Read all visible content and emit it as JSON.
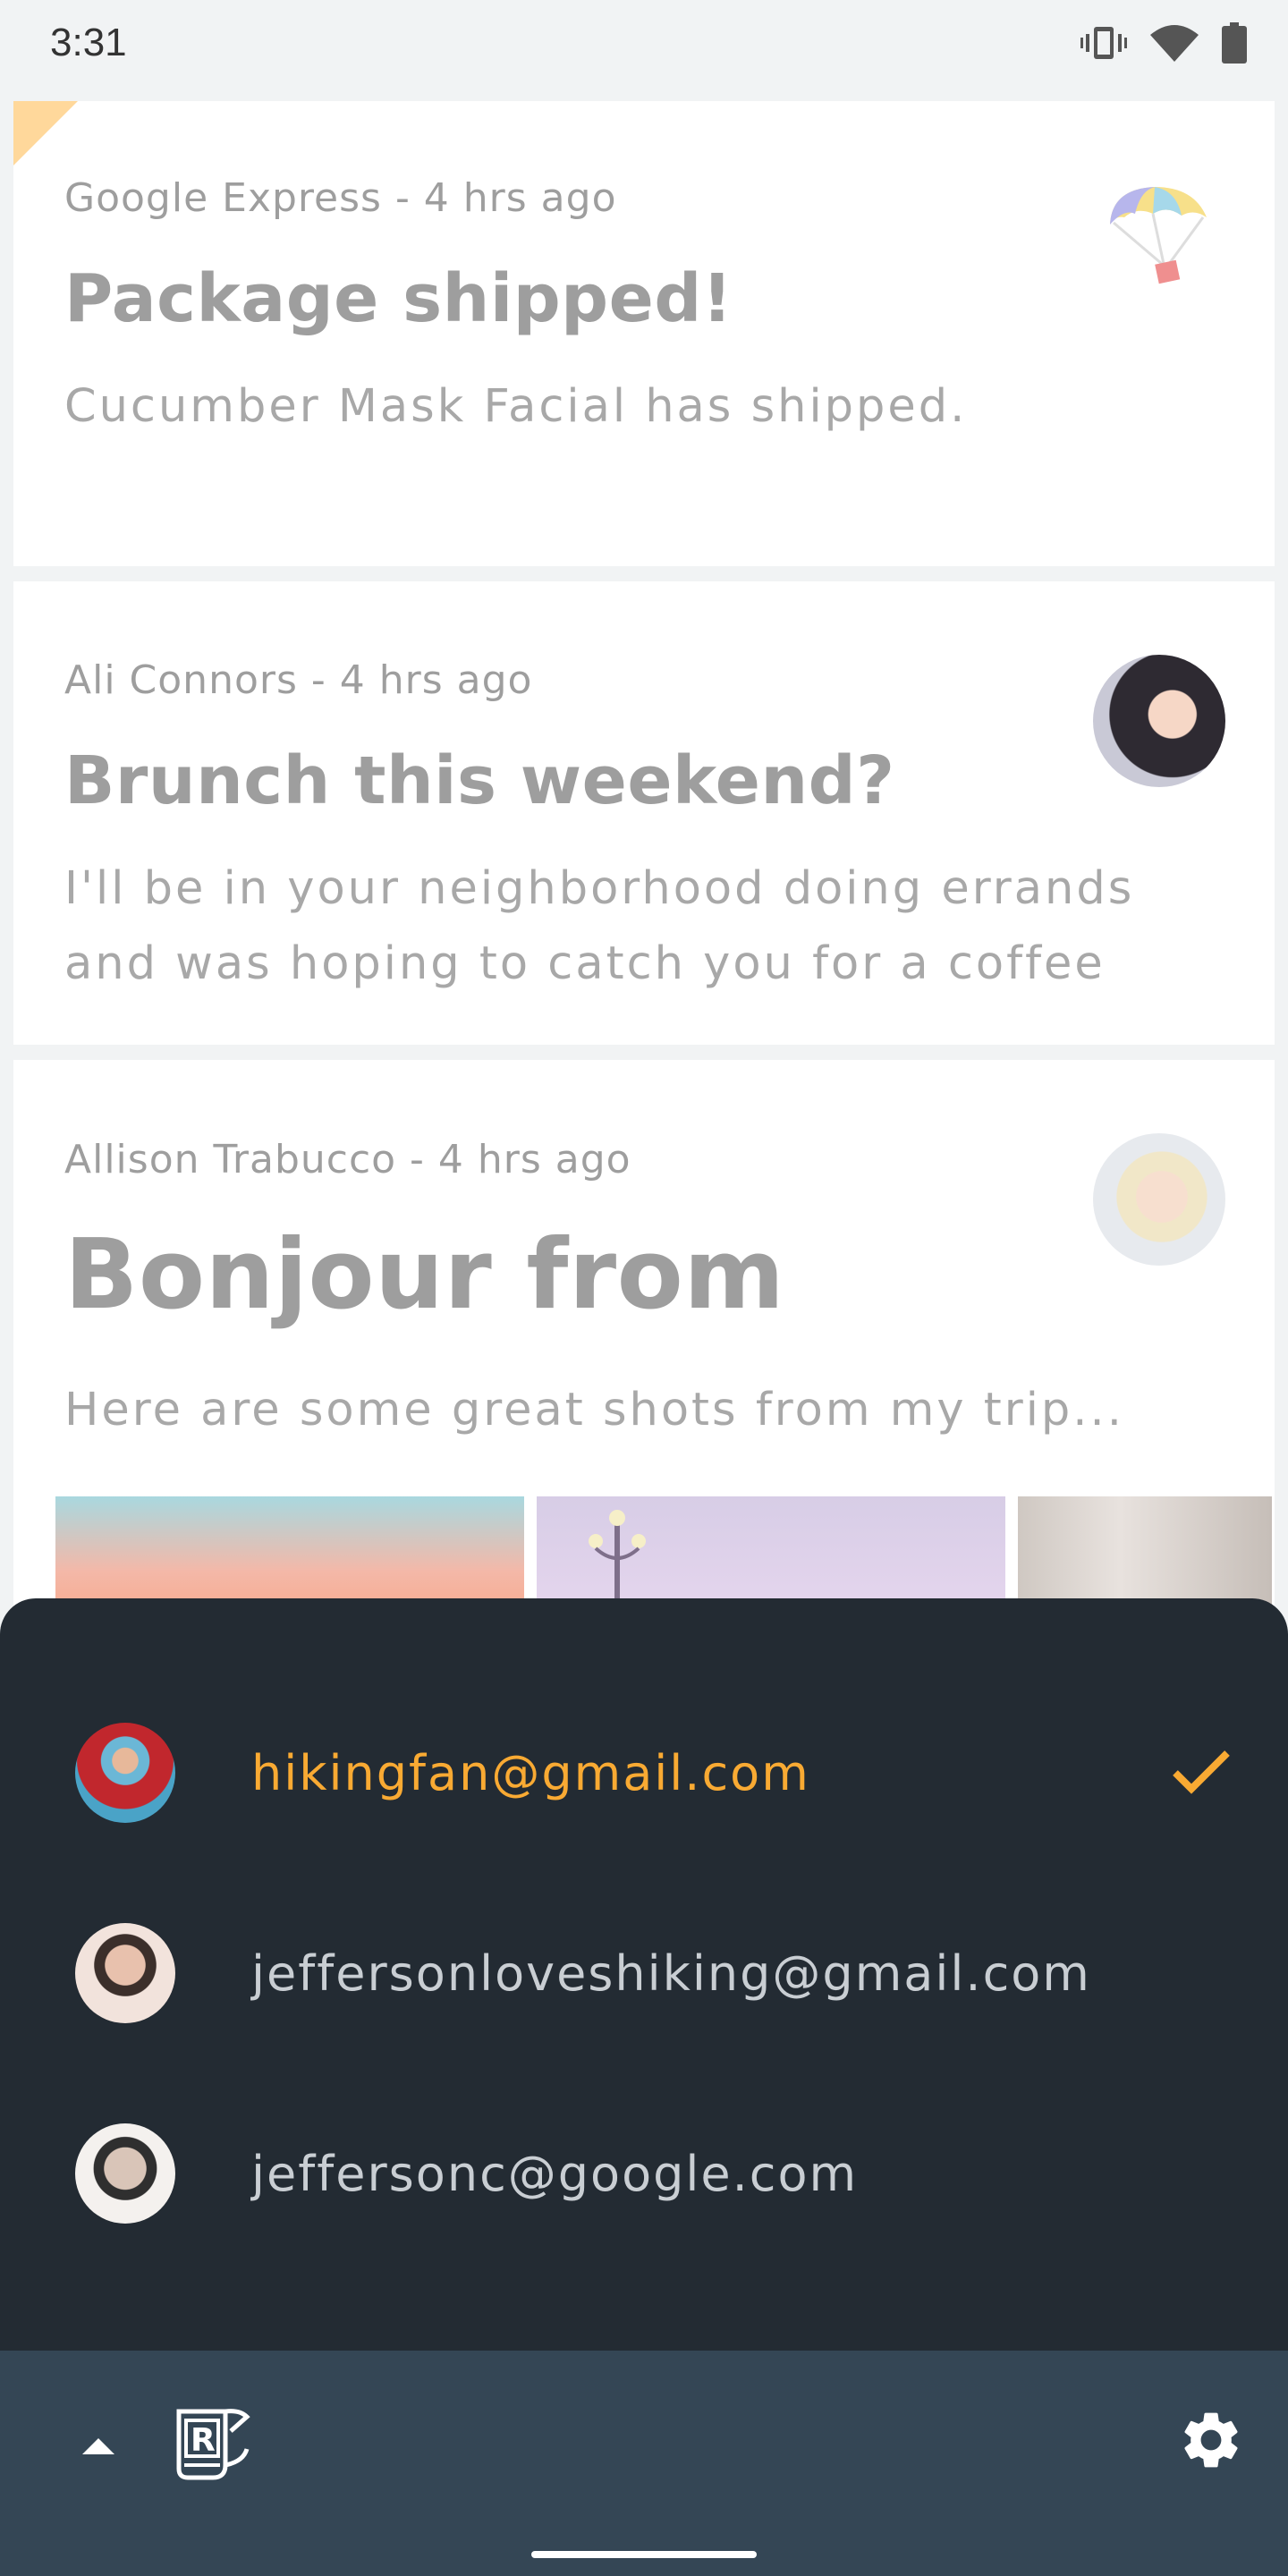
{
  "status_bar": {
    "time": "3:31",
    "icons": [
      "vibrate-icon",
      "wifi-icon",
      "battery-icon"
    ]
  },
  "mails": [
    {
      "meta": "Google Express - 4 hrs ago",
      "title": "Package shipped!",
      "body": "Cucumber Mask Facial has shipped.",
      "icon": "parachute-icon"
    },
    {
      "meta": "Ali Connors - 4 hrs ago",
      "title": "Brunch this weekend?",
      "body": "I'll be in your neighborhood doing errands and was hoping to catch you for a coffee",
      "icon": "avatar"
    },
    {
      "meta": "Allison Trabucco - 4 hrs ago",
      "title": "Bonjour from",
      "body": "Here are some great shots from my trip...",
      "icon": "avatar"
    }
  ],
  "accounts": [
    {
      "email": "hikingfan@gmail.com",
      "selected": true
    },
    {
      "email": "jeffersonloveshiking@gmail.com",
      "selected": false
    },
    {
      "email": "jeffersonc@google.com",
      "selected": false
    }
  ],
  "app_bar": {
    "icons": [
      "arrow-up-icon",
      "reply-logo-icon",
      "gear-icon"
    ]
  },
  "colors": {
    "accent": "#f9aa33",
    "sheet": "#232b33",
    "app_bar": "#344655",
    "card": "#ffffff"
  }
}
